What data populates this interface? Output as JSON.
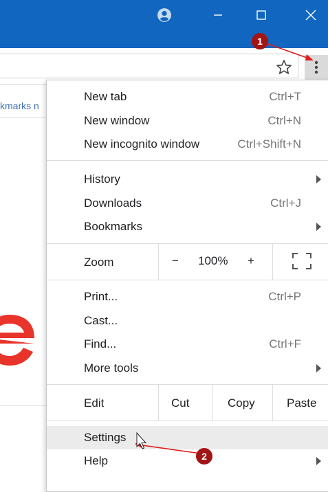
{
  "page": {
    "bookmarks_text": "kmarks n"
  },
  "menu": {
    "new_tab": {
      "label": "New tab",
      "shortcut": "Ctrl+T"
    },
    "new_window": {
      "label": "New window",
      "shortcut": "Ctrl+N"
    },
    "new_incognito": {
      "label": "New incognito window",
      "shortcut": "Ctrl+Shift+N"
    },
    "history": {
      "label": "History"
    },
    "downloads": {
      "label": "Downloads",
      "shortcut": "Ctrl+J"
    },
    "bookmarks": {
      "label": "Bookmarks"
    },
    "zoom": {
      "label": "Zoom",
      "minus": "−",
      "value": "100%",
      "plus": "+"
    },
    "print": {
      "label": "Print...",
      "shortcut": "Ctrl+P"
    },
    "cast": {
      "label": "Cast..."
    },
    "find": {
      "label": "Find...",
      "shortcut": "Ctrl+F"
    },
    "more_tools": {
      "label": "More tools"
    },
    "edit": {
      "label": "Edit",
      "cut": "Cut",
      "copy": "Copy",
      "paste": "Paste"
    },
    "settings": {
      "label": "Settings"
    },
    "help": {
      "label": "Help"
    }
  },
  "annotations": {
    "step1": "1",
    "step2": "2"
  },
  "colors": {
    "titlebar": "#1166bf",
    "annotation": "#a31414",
    "logo": "#e8342a"
  },
  "icons": {
    "profile": "profile-icon",
    "minimize": "minimize-icon",
    "maximize": "maximize-icon",
    "close": "close-icon",
    "star": "star-icon",
    "menu": "kebab-menu-icon",
    "fullscreen": "fullscreen-icon"
  }
}
